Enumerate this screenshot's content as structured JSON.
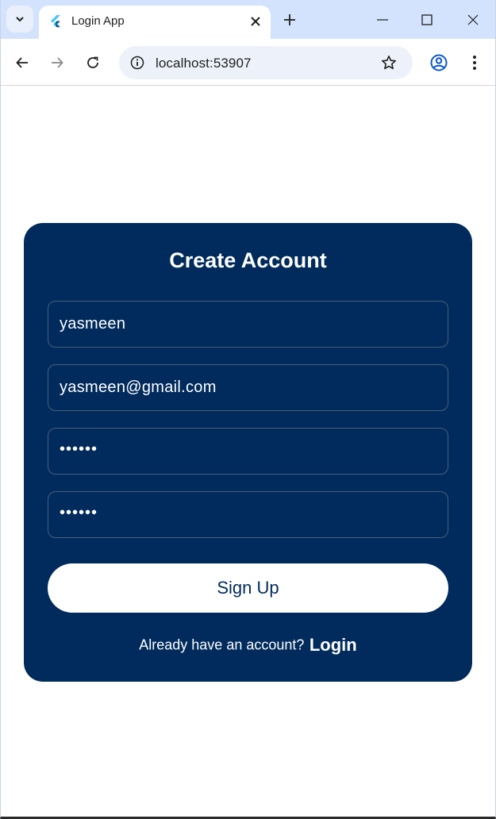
{
  "browser": {
    "tab_title": "Login App",
    "url": "localhost:53907",
    "icons": {
      "tab_search": "chevron-down-icon",
      "favicon": "flutter-logo-icon",
      "tab_close": "close-icon",
      "new_tab": "plus-icon",
      "minimize": "minimize-icon",
      "maximize": "maximize-icon",
      "close_window": "close-window-icon",
      "back": "back-arrow-icon",
      "forward": "forward-arrow-icon",
      "reload": "reload-icon",
      "site_info": "info-icon",
      "bookmark": "star-icon",
      "profile": "profile-icon",
      "menu": "kebab-menu-icon"
    },
    "colors": {
      "tabstrip": "#d3e3fd",
      "omnibox": "#edf2fa",
      "profile_accent": "#0b57d0"
    }
  },
  "form": {
    "title": "Create Account",
    "fields": [
      {
        "value": "yasmeen"
      },
      {
        "value": "yasmeen@gmail.com"
      },
      {
        "value": "••••••"
      },
      {
        "value": "••••••"
      }
    ],
    "submit_label": "Sign Up",
    "footer_text": "Already have an account?",
    "footer_link": "Login",
    "colors": {
      "card_background": "#002b5c",
      "field_border": "#4a5f7a",
      "button_background": "#ffffff",
      "button_text": "#002b5c"
    }
  }
}
